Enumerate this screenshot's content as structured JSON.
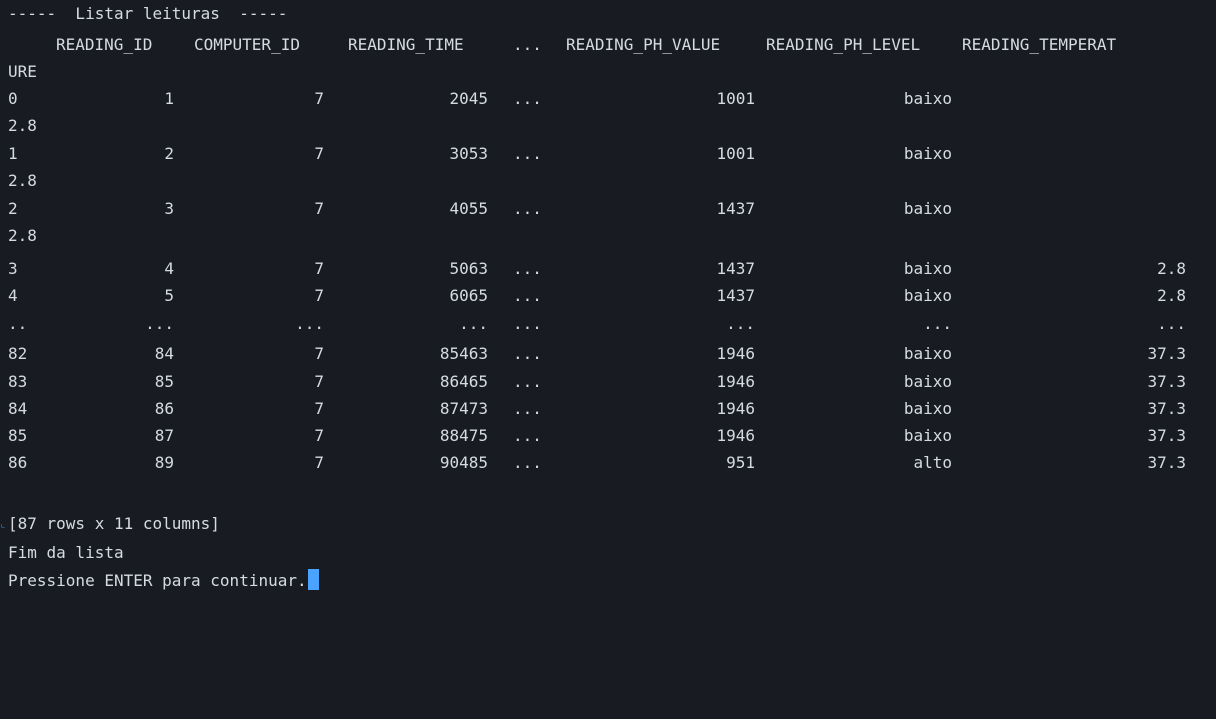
{
  "title_line": "-----  Listar leituras  -----",
  "header": {
    "reading_id": "READING_ID",
    "computer_id": "COMPUTER_ID",
    "reading_time": "READING_TIME",
    "ellipsis": "...",
    "ph_value": "READING_PH_VALUE",
    "ph_level": "READING_PH_LEVEL",
    "temperature_part1": "READING_TEMPERAT",
    "temperature_part2": "URE"
  },
  "rows": [
    {
      "idx": "0",
      "id": "1",
      "comp": "7",
      "time": "2045",
      "dots": "...",
      "ph": "1001",
      "level": "baixo",
      "temp": "2.8"
    },
    {
      "idx": "1",
      "id": "2",
      "comp": "7",
      "time": "3053",
      "dots": "...",
      "ph": "1001",
      "level": "baixo",
      "temp": "2.8"
    },
    {
      "idx": "2",
      "id": "3",
      "comp": "7",
      "time": "4055",
      "dots": "...",
      "ph": "1437",
      "level": "baixo",
      "temp": "2.8"
    },
    {
      "idx": "3",
      "id": "4",
      "comp": "7",
      "time": "5063",
      "dots": "...",
      "ph": "1437",
      "level": "baixo",
      "temp": "2.8"
    },
    {
      "idx": "4",
      "id": "5",
      "comp": "7",
      "time": "6065",
      "dots": "...",
      "ph": "1437",
      "level": "baixo",
      "temp": "2.8"
    },
    {
      "idx": "..",
      "id": "...",
      "comp": "...",
      "time": "...",
      "dots": "...",
      "ph": "...",
      "level": "...",
      "temp": "..."
    },
    {
      "idx": "82",
      "id": "84",
      "comp": "7",
      "time": "85463",
      "dots": "...",
      "ph": "1946",
      "level": "baixo",
      "temp": "37.3"
    },
    {
      "idx": "83",
      "id": "85",
      "comp": "7",
      "time": "86465",
      "dots": "...",
      "ph": "1946",
      "level": "baixo",
      "temp": "37.3"
    },
    {
      "idx": "84",
      "id": "86",
      "comp": "7",
      "time": "87473",
      "dots": "...",
      "ph": "1946",
      "level": "baixo",
      "temp": "37.3"
    },
    {
      "idx": "85",
      "id": "87",
      "comp": "7",
      "time": "88475",
      "dots": "...",
      "ph": "1946",
      "level": "baixo",
      "temp": "37.3"
    },
    {
      "idx": "86",
      "id": "89",
      "comp": "7",
      "time": "90485",
      "dots": "...",
      "ph": "951",
      "level": "alto",
      "temp": "37.3"
    }
  ],
  "summary": "[87 rows x 11 columns]",
  "end_message": "Fim da lista",
  "prompt": "Pressione ENTER para continuar.",
  "colors": {
    "background": "#181c22",
    "text": "#d6dbe3",
    "cursor": "#4aa3ff"
  }
}
